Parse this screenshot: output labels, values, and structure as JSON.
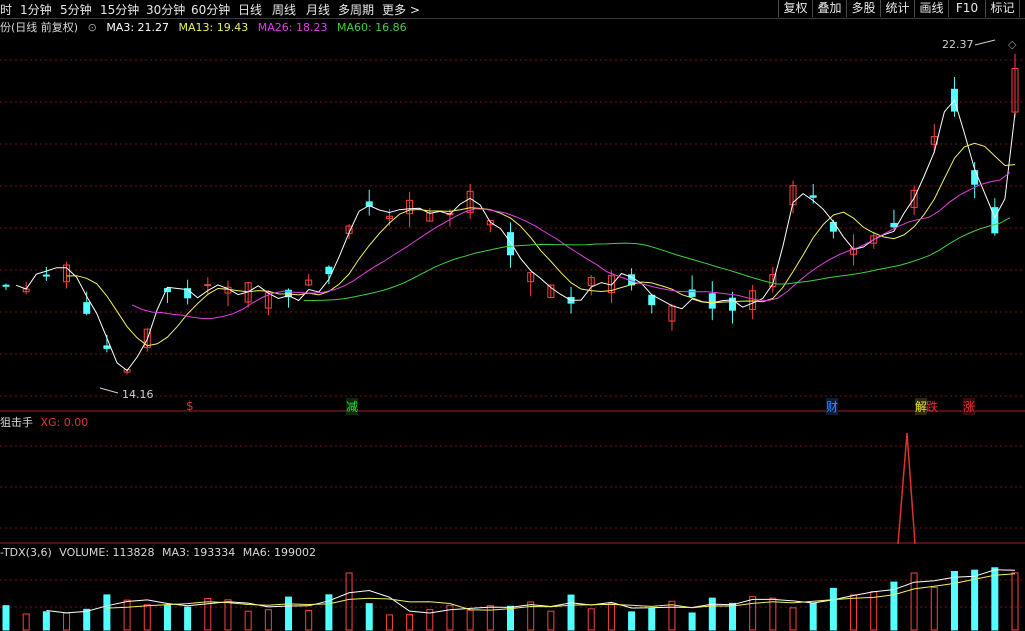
{
  "toolbar": {
    "periods": [
      "时",
      "1分钟",
      "5分钟",
      "15分钟",
      "30分钟",
      "60分钟",
      "日线",
      "周线",
      "月线",
      "多周期",
      "更多 >"
    ],
    "buttons": [
      "复权",
      "叠加",
      "多股",
      "统计",
      "画线",
      "F10",
      "标记"
    ]
  },
  "main_chart": {
    "title": "份(日线 前复权)",
    "indicators": [
      {
        "label": "MA3: 21.27",
        "color": "#ffffff"
      },
      {
        "label": "MA13: 19.43",
        "color": "#f0f060"
      },
      {
        "label": "MA26: 18.23",
        "color": "#e040e0"
      },
      {
        "label": "MA60: 16.86",
        "color": "#40d040"
      }
    ],
    "high_label": "22.37",
    "low_label": "14.16",
    "event_markers": [
      {
        "text": "$",
        "color": "#e03030"
      },
      {
        "text": "减",
        "color": "#40d040"
      },
      {
        "text": "财",
        "color": "#3090ff"
      },
      {
        "text": "解",
        "color": "#e0e040"
      },
      {
        "text": "跌",
        "color": "#e03030"
      },
      {
        "text": "涨",
        "color": "#e03030"
      }
    ]
  },
  "sub_chart_1": {
    "name": "狙击手",
    "indicator": "XG: 0.00"
  },
  "sub_chart_2": {
    "name": "-TDX(3,6)",
    "indicators": [
      "VOLUME: 113828",
      "MA3: 193334",
      "MA6: 199002"
    ]
  },
  "chart_data": {
    "type": "candlestick",
    "price_range": [
      14.16,
      22.37
    ],
    "ma_values": {
      "MA3": 21.27,
      "MA13": 19.43,
      "MA26": 18.23,
      "MA60": 16.86
    },
    "xg_value": 0.0,
    "volume": {
      "last": 113828,
      "MA3": 193334,
      "MA6": 199002
    }
  },
  "colors": {
    "up": "#ff4040",
    "down": "#54ffff",
    "grid": "#7a1010",
    "ma3": "#ffffff",
    "ma13": "#f0f060",
    "ma26": "#e040e0",
    "ma60": "#40d040"
  }
}
